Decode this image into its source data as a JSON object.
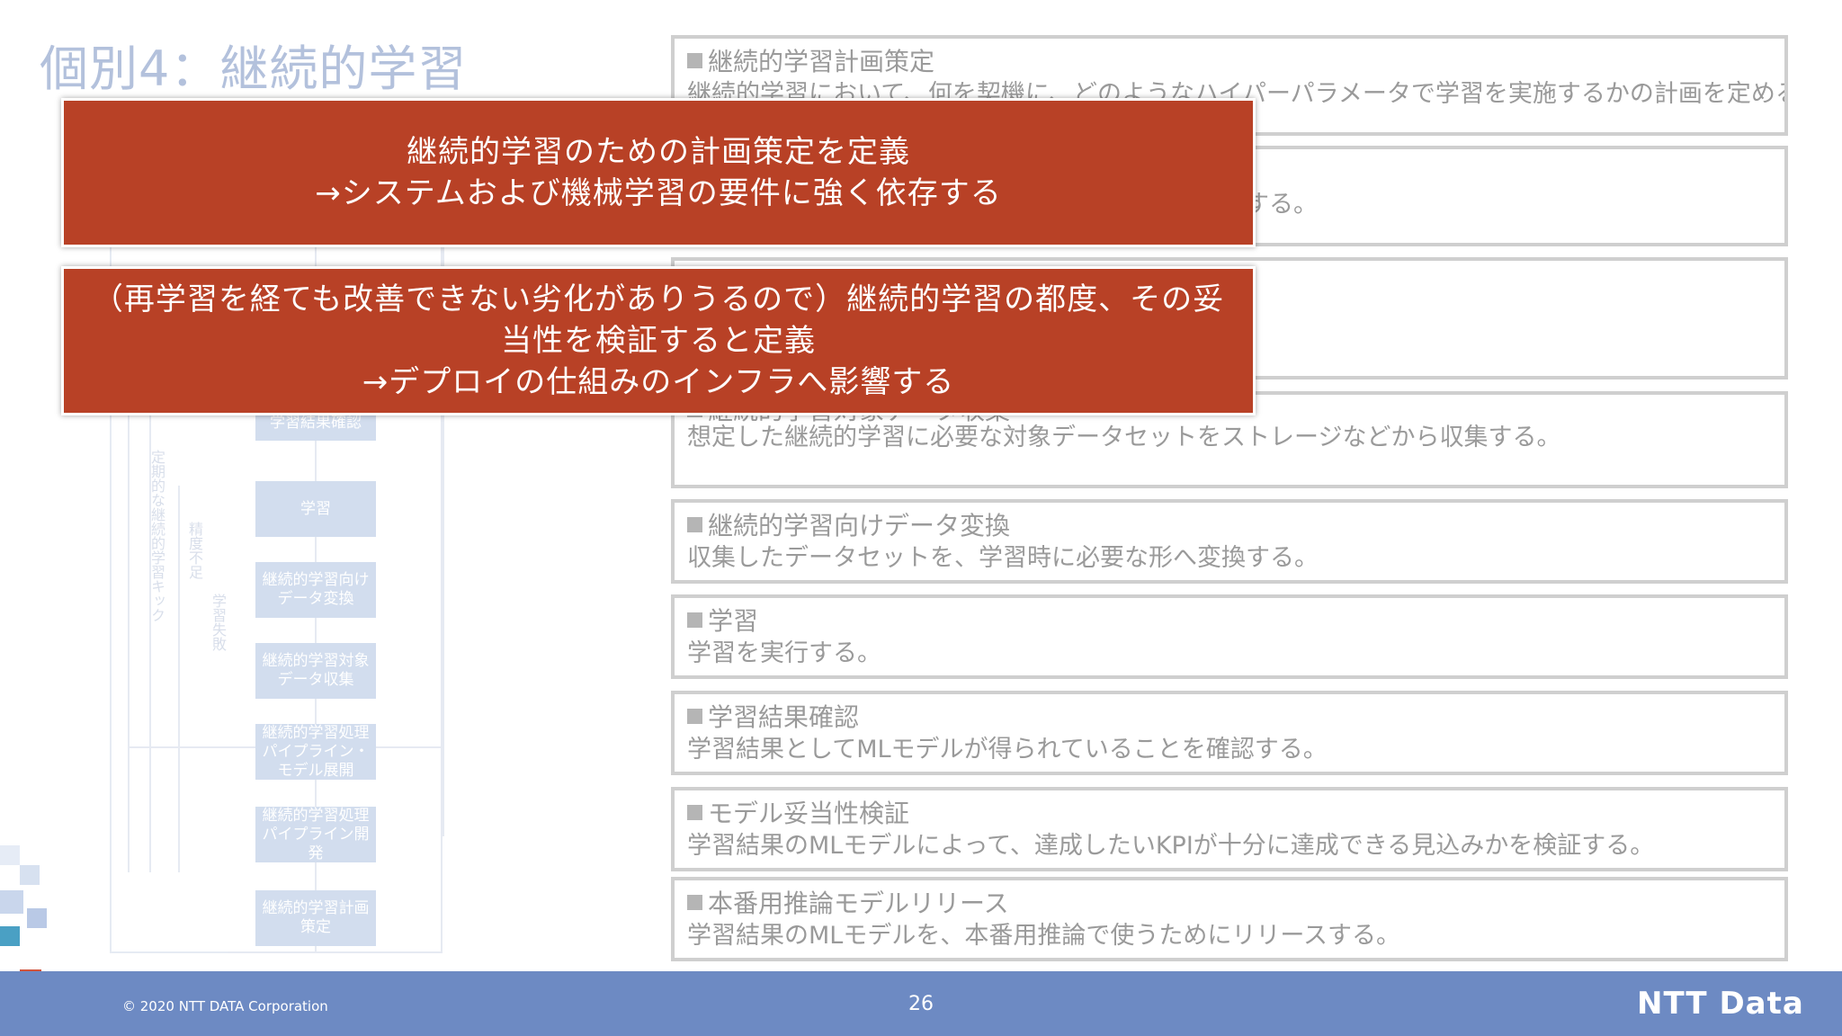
{
  "title": "個別4：継続的学習",
  "boxes": [
    {
      "heading": "継続的学習計画策定",
      "desc": "継続的学習において、何を契機に、どのようなハイパーパラメータで学習を実施するかの計画を定める。"
    },
    {
      "heading": "",
      "desc": "する。"
    },
    {
      "heading": "",
      "desc": ""
    },
    {
      "heading": "継続的学習対象データ収集",
      "desc": "想定した継続的学習に必要な対象データセットをストレージなどから収集する。"
    },
    {
      "heading": "継続的学習向けデータ変換",
      "desc": "収集したデータセットを、学習時に必要な形へ変換する。"
    },
    {
      "heading": "学習",
      "desc": "学習を実行する。"
    },
    {
      "heading": "学習結果確認",
      "desc": "学習結果としてMLモデルが得られていることを確認する。"
    },
    {
      "heading": "モデル妥当性検証",
      "desc": "学習結果のMLモデルによって、達成したいKPIが十分に達成できる見込みかを検証する。"
    },
    {
      "heading": "本番用推論モデルリリース",
      "desc": "学習結果のMLモデルを、本番用推論で使うためにリリースする。"
    }
  ],
  "callouts": [
    {
      "line1": "継続的学習のための計画策定を定義",
      "line2": "→システムおよび機械学習の要件に強く依存する",
      "line3": ""
    },
    {
      "line1": "（再学習を経ても改善できない劣化がありうるので）継続的学習の都度、その妥",
      "line2": "当性を検証すると定義",
      "line3": "→デプロイの仕組みのインフラへ影響する"
    }
  ],
  "diagram": {
    "nodes": [
      "学習結果確認",
      "学習",
      "継続的学習向けデータ変換",
      "継続的学習対象データ収集",
      "継続的学習処理パイプライン・モデル展開",
      "継続的学習処理パイプライン開発",
      "継続的学習計画策定"
    ],
    "side_labels": [
      "定期的な継続的学習キック",
      "精度不足",
      "学習失敗"
    ]
  },
  "footer": {
    "copyright": "© 2020 NTT DATA Corporation",
    "page_number": "26",
    "logo": "NTT Data"
  },
  "colors": {
    "callout": "#b84126",
    "footer": "#6d8ac3",
    "title": "#b3c1dc"
  }
}
